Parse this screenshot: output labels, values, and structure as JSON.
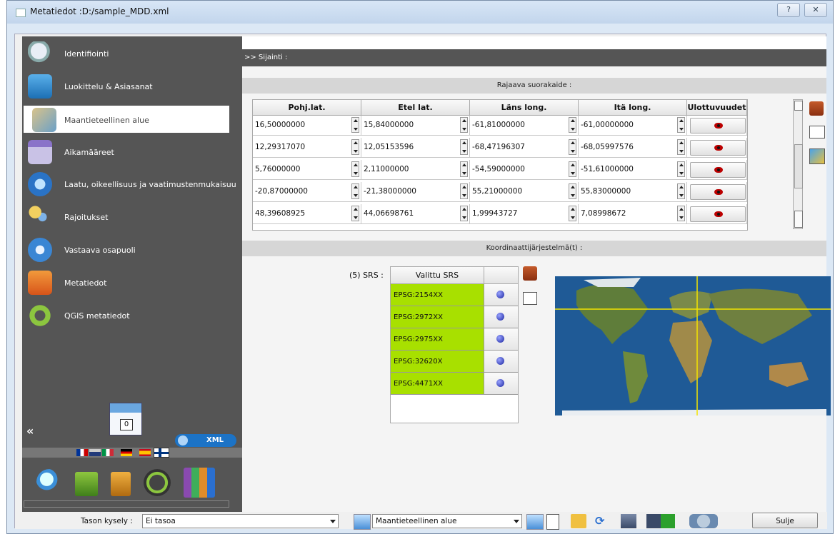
{
  "window": {
    "title": "Metatiedot :D:/sample_MDD.xml",
    "help_button": "?",
    "close_button": "✕"
  },
  "sidebar": {
    "items": [
      {
        "label": "Identifiointi",
        "icon": "magnifier-icon"
      },
      {
        "label": "Luokittelu & Asiasanat",
        "icon": "drawer-icon"
      },
      {
        "label": "Maantieteellinen alue",
        "icon": "map-icon",
        "active": true
      },
      {
        "label": "Aikamääreet",
        "icon": "calendar-icon"
      },
      {
        "label": "Laatu, oikeellisuus ja vaatimustenmukaisuus",
        "icon": "quality-badge-icon"
      },
      {
        "label": "Rajoitukset",
        "icon": "keys-icon"
      },
      {
        "label": "Vastaava osapuoli",
        "icon": "people-icon"
      },
      {
        "label": "Metatiedot",
        "icon": "id-card-icon"
      },
      {
        "label": "QGIS metatiedot",
        "icon": "qgis-icon"
      }
    ],
    "collapse_label": "«",
    "counter": "0",
    "xml_label": "XML"
  },
  "main": {
    "section_title": ">> Sijainti :",
    "bbox_title": "Rajaava suorakaide :",
    "bbox_columns": [
      "Pohj.lat.",
      "Etel lat.",
      "Läns long.",
      "Itä long.",
      "Ulottuvuudet"
    ],
    "bbox_rows": [
      [
        "16,50000000",
        "15,84000000",
        "-61,81000000",
        "-61,00000000"
      ],
      [
        "12,29317070",
        "12,05153596",
        "-68,47196307",
        "-68,05997576"
      ],
      [
        "5,76000000",
        "2,11000000",
        "-54,59000000",
        "-51,61000000"
      ],
      [
        "-20,87000000",
        "-21,38000000",
        "55,21000000",
        "55,83000000"
      ],
      [
        "48,39608925",
        "44,06698761",
        "1,99943727",
        "7,08998672"
      ]
    ],
    "crs_title": "Koordinaattijärjestelmä(t) :",
    "srs_label": "(5) SRS :",
    "srs_header": "Valittu SRS",
    "srs_rows": [
      "EPSG:2154XX",
      "EPSG:2972XX",
      "EPSG:2975XX",
      "EPSG:32620X",
      "EPSG:4471XX"
    ],
    "srs_row_color": "#a8e000"
  },
  "bottombar": {
    "query_label": "Tason kysely :",
    "query_value": "Ei tasoa",
    "section_value": "Maantieteellinen alue",
    "close_button": "Sulje"
  }
}
